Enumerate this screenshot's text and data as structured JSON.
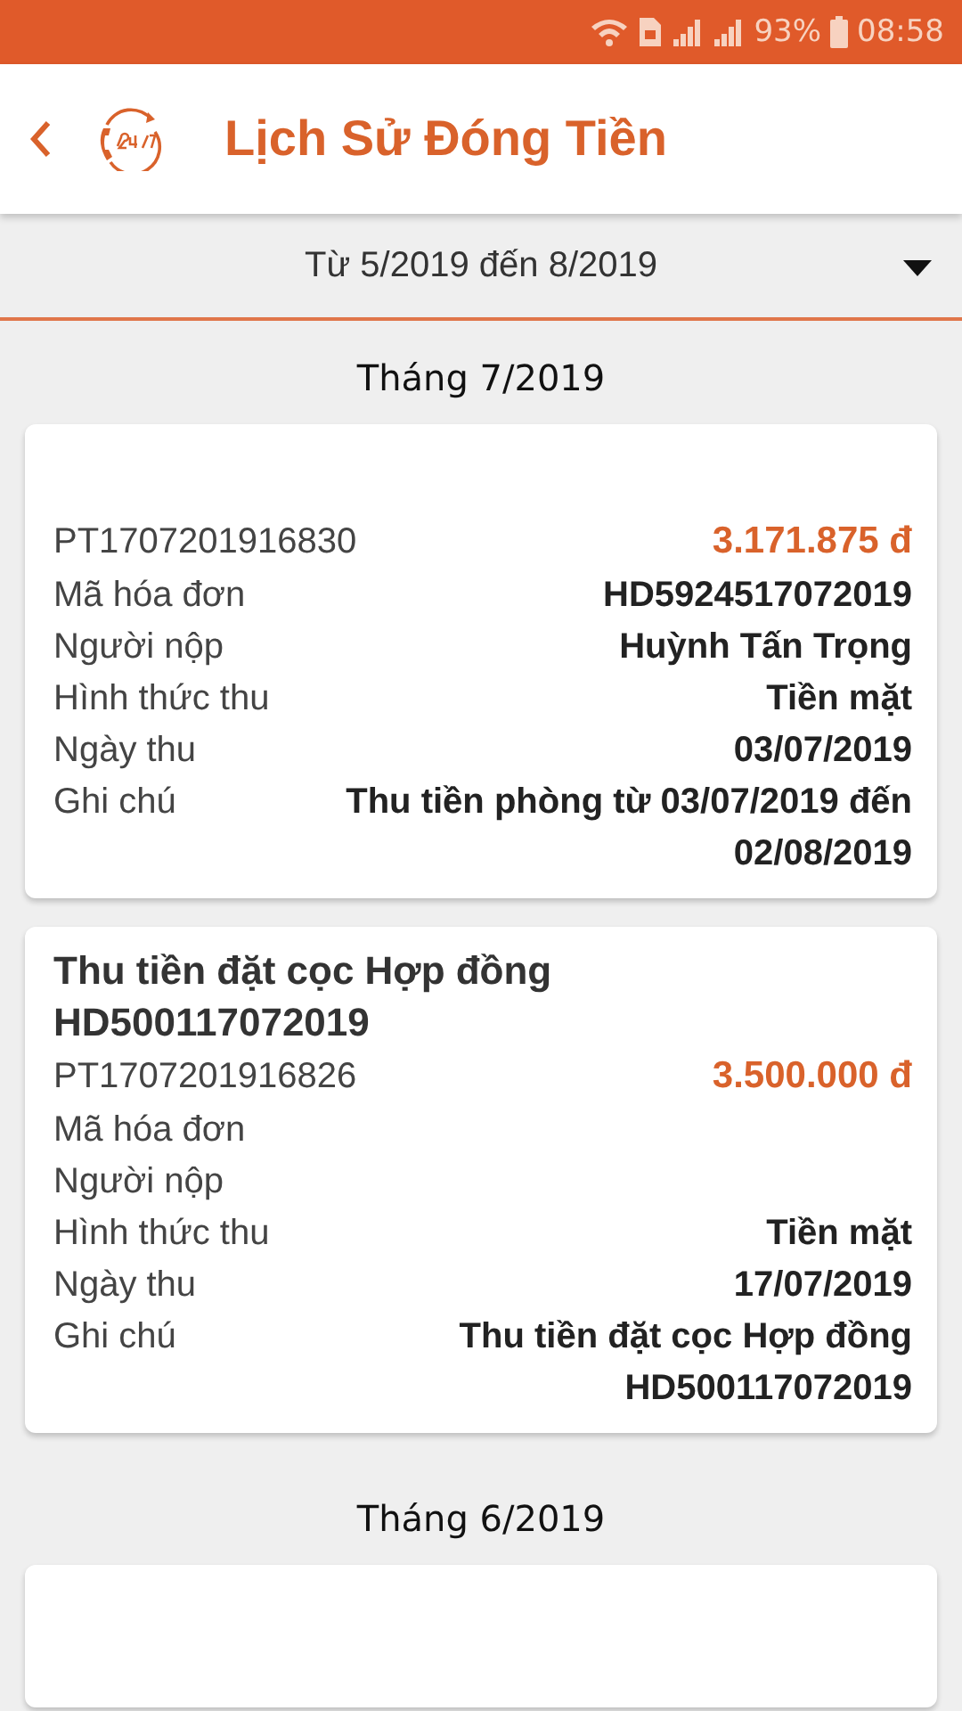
{
  "status_bar": {
    "battery": "93%",
    "time": "08:58"
  },
  "header": {
    "title": "Lịch Sử Đóng Tiền"
  },
  "filter": {
    "value": "Từ 5/2019 đến 8/2019"
  },
  "sections": [
    {
      "title": "Tháng 7/2019",
      "cards": [
        {
          "kind": "receipt",
          "receipt_no": "PT1707201916830",
          "amount": "3.171.875 đ",
          "rows": [
            {
              "label": "Mã hóa đơn",
              "value": "HD5924517072019"
            },
            {
              "label": "Người nộp",
              "value": "Huỳnh Tấn Trọng"
            },
            {
              "label": "Hình thức thu",
              "value": "Tiền mặt"
            },
            {
              "label": "Ngày thu",
              "value": "03/07/2019"
            },
            {
              "label": "Ghi chú",
              "value": "Thu tiền phòng từ 03/07/2019 đến 02/08/2019"
            }
          ]
        },
        {
          "kind": "receipt",
          "title": "Thu tiền đặt cọc Hợp đồng HD500117072019",
          "receipt_no": "PT1707201916826",
          "amount": "3.500.000 đ",
          "rows": [
            {
              "label": "Mã hóa đơn"
            },
            {
              "label": "Người nộp"
            },
            {
              "label": "Hình thức thu",
              "value": "Tiền mặt"
            },
            {
              "label": "Ngày thu",
              "value": "17/07/2019"
            },
            {
              "label": "Ghi chú",
              "value": "Thu tiền đặt cọc Hợp đồng HD500117072019"
            }
          ]
        }
      ]
    },
    {
      "title": "Tháng 6/2019",
      "cards": [
        {
          "kind": "receipt"
        }
      ]
    }
  ]
}
